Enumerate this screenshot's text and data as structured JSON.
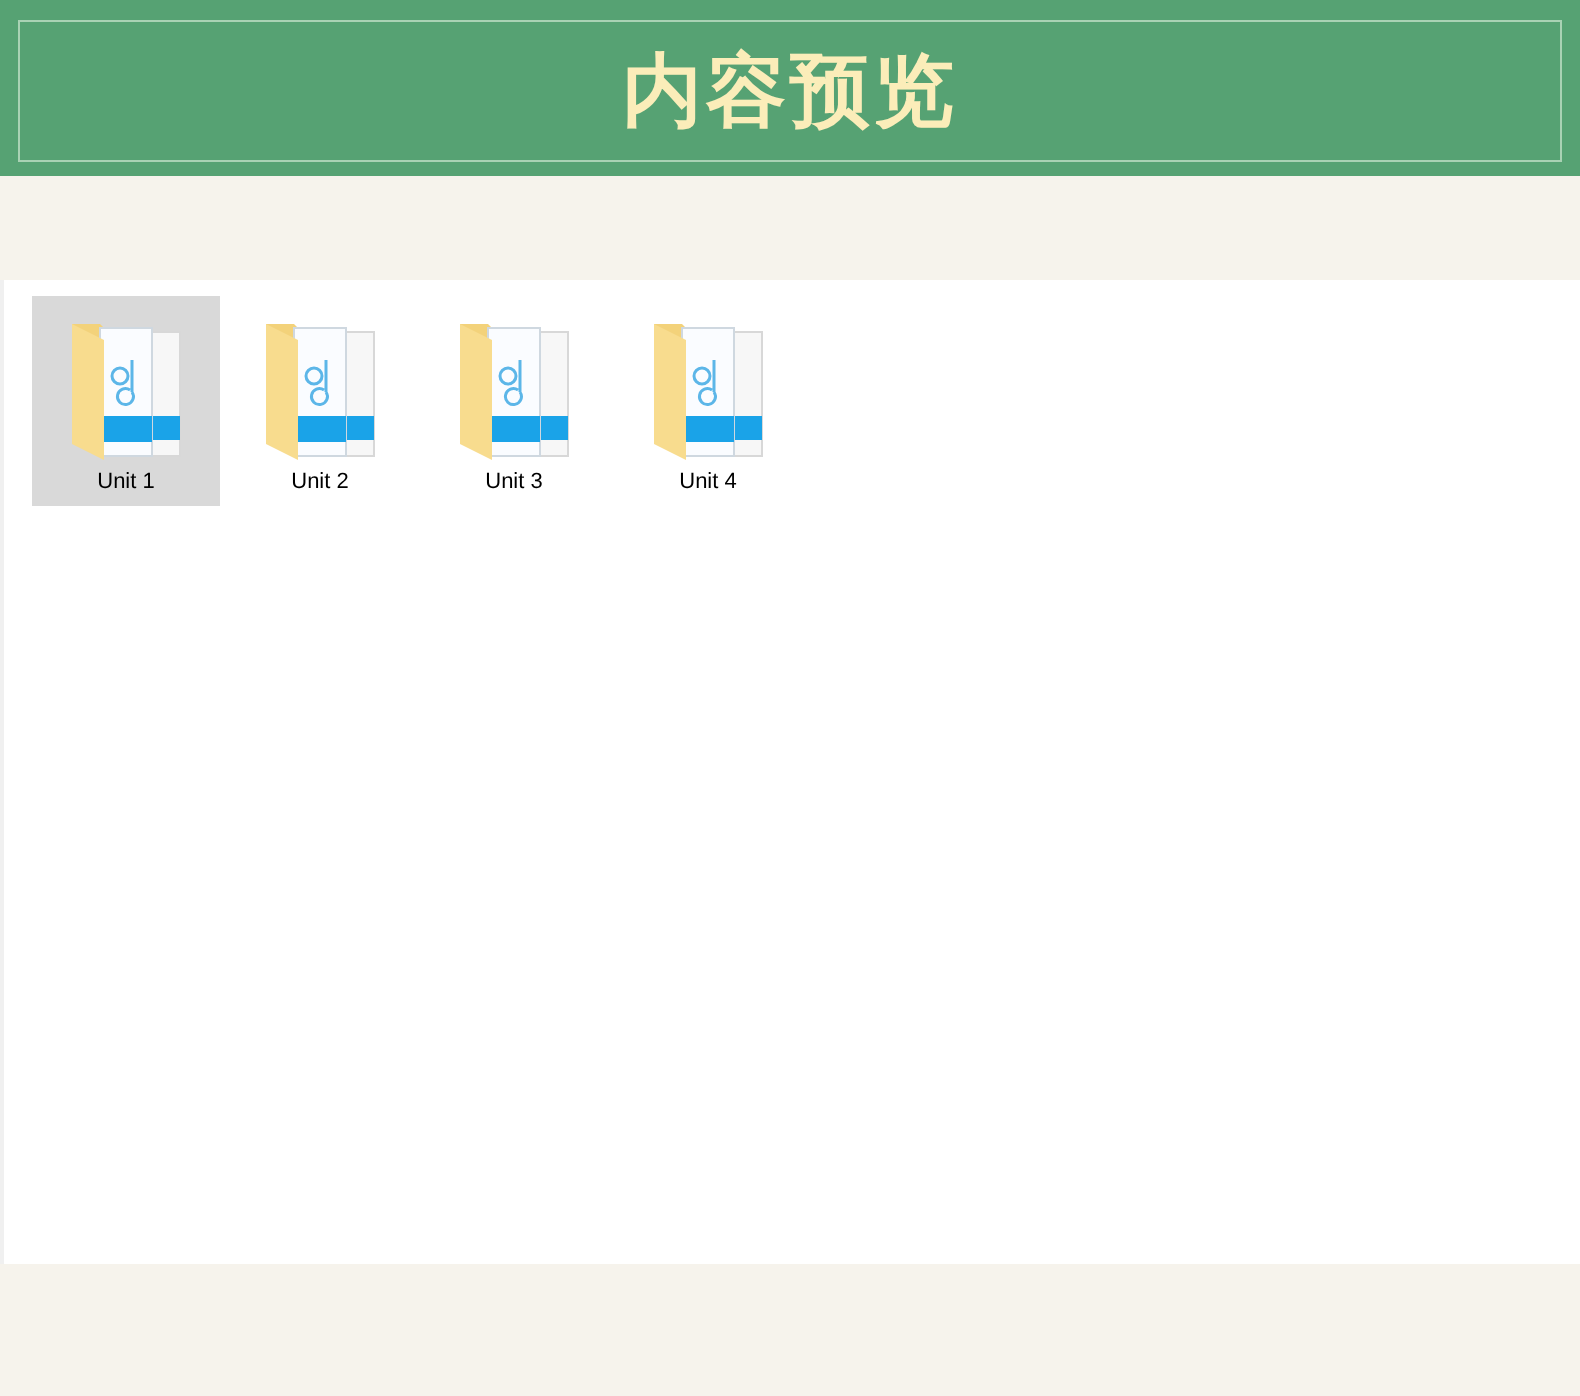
{
  "header": {
    "title": "内容预览"
  },
  "folders": [
    {
      "name": "Unit 1",
      "selected": true
    },
    {
      "name": "Unit 2",
      "selected": false
    },
    {
      "name": "Unit 3",
      "selected": false
    },
    {
      "name": "Unit 4",
      "selected": false
    }
  ]
}
